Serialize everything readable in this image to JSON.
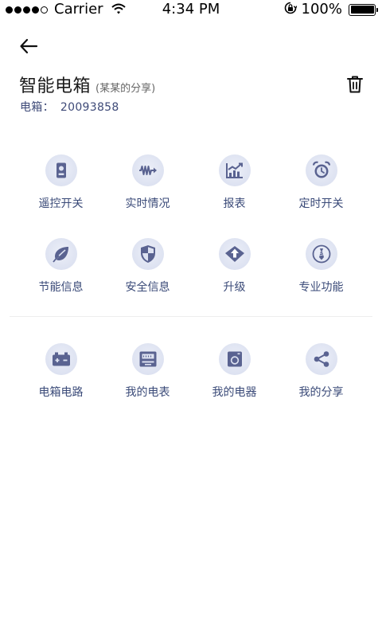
{
  "status_bar": {
    "carrier": "Carrier",
    "time": "4:34 PM",
    "battery": "100%"
  },
  "header": {
    "title": "智能电箱",
    "share_note": "(某某的分享)",
    "box_label": "电箱：",
    "box_number": "20093858"
  },
  "functions": [
    {
      "label": "遥控开关",
      "icon": "remote-icon"
    },
    {
      "label": "实时情况",
      "icon": "wave-icon"
    },
    {
      "label": "报表",
      "icon": "chart-icon"
    },
    {
      "label": "定时开关",
      "icon": "alarm-clock-icon"
    },
    {
      "label": "节能信息",
      "icon": "leaf-icon"
    },
    {
      "label": "安全信息",
      "icon": "shield-icon"
    },
    {
      "label": "升级",
      "icon": "upgrade-icon"
    },
    {
      "label": "专业功能",
      "icon": "tie-icon"
    }
  ],
  "devices": [
    {
      "label": "电箱电路",
      "icon": "battery-circuit-icon"
    },
    {
      "label": "我的电表",
      "icon": "meter-icon"
    },
    {
      "label": "我的电器",
      "icon": "appliance-icon"
    },
    {
      "label": "我的分享",
      "icon": "share-icon"
    }
  ],
  "colors": {
    "icon_fill": "#5a6391",
    "icon_bg": "#dde2f1",
    "label_text": "#3a4a78"
  }
}
